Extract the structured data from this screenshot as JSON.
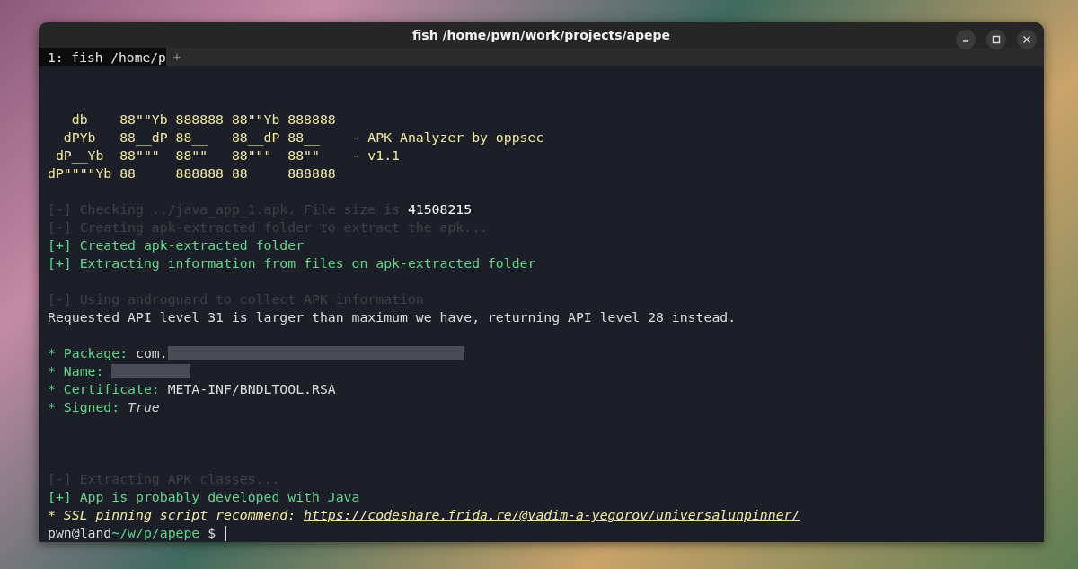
{
  "window": {
    "title": "fish /home/pwn/work/projects/apepe"
  },
  "tabs": [
    {
      "label": "1: fish /home/p",
      "selected": true
    }
  ],
  "new_tab": "+",
  "lines": [
    {
      "kind": "blank"
    },
    {
      "kind": "blank"
    },
    {
      "kind": "text",
      "segments": [
        {
          "kind": "banner",
          "text": "   db    88\"\"Yb 888888 88\"\"Yb 888888"
        }
      ]
    },
    {
      "kind": "text",
      "segments": [
        {
          "kind": "banner",
          "text": "  dPYb   88__dP 88__   88__dP 88__    - APK Analyzer by oppsec"
        }
      ]
    },
    {
      "kind": "text",
      "segments": [
        {
          "kind": "banner",
          "text": " dP__Yb  88\"\"\"  88\"\"   88\"\"\"  88\"\"    - v1.1"
        }
      ]
    },
    {
      "kind": "text",
      "segments": [
        {
          "kind": "banner",
          "text": "dP\"\"\"\"Yb 88     888888 88     888888"
        }
      ]
    },
    {
      "kind": "blank"
    },
    {
      "kind": "text",
      "segments": [
        {
          "kind": "dim",
          "text": "[-] Checking ../java_app_1.apk. File size is "
        },
        {
          "kind": "bright",
          "text": "41508215"
        }
      ]
    },
    {
      "kind": "text",
      "segments": [
        {
          "kind": "dim",
          "text": "[-] Creating apk-extracted folder to extract the apk..."
        }
      ]
    },
    {
      "kind": "text",
      "segments": [
        {
          "kind": "ok",
          "text": "[+] Created apk-extracted folder"
        }
      ]
    },
    {
      "kind": "text",
      "segments": [
        {
          "kind": "ok",
          "text": "[+] Extracting information from files on apk-extracted folder"
        }
      ]
    },
    {
      "kind": "blank"
    },
    {
      "kind": "text",
      "segments": [
        {
          "kind": "dim",
          "text": "[-] Using androguard to collect APK information"
        }
      ]
    },
    {
      "kind": "text",
      "segments": [
        {
          "kind": "plain",
          "text": "Requested API level 31 is larger than maximum we have, returning API level 28 instead."
        }
      ]
    },
    {
      "kind": "blank"
    },
    {
      "kind": "text",
      "segments": [
        {
          "kind": "ok",
          "text": "* Package: "
        },
        {
          "kind": "plain",
          "text": "com."
        },
        {
          "kind": "redacted_long"
        }
      ]
    },
    {
      "kind": "text",
      "segments": [
        {
          "kind": "ok",
          "text": "* Name: "
        },
        {
          "kind": "redacted_short"
        }
      ]
    },
    {
      "kind": "text",
      "segments": [
        {
          "kind": "ok",
          "text": "* Certificate: "
        },
        {
          "kind": "plain",
          "text": "META-INF/BNDLTOOL.RSA"
        }
      ]
    },
    {
      "kind": "text",
      "segments": [
        {
          "kind": "ok",
          "text": "* Signed: "
        },
        {
          "kind": "italic",
          "text": "True"
        }
      ]
    },
    {
      "kind": "blank"
    },
    {
      "kind": "blank"
    },
    {
      "kind": "blank"
    },
    {
      "kind": "text",
      "segments": [
        {
          "kind": "dim",
          "text": "[-] Extracting APK classes..."
        }
      ]
    },
    {
      "kind": "text",
      "segments": [
        {
          "kind": "ok",
          "text": "[+] App is probably developed with Java"
        }
      ]
    },
    {
      "kind": "text",
      "segments": [
        {
          "kind": "note",
          "text": "* SSL pinning script recommend: "
        },
        {
          "kind": "link",
          "text": "https://codeshare.frida.re/@vadim-a-yegorov/universalunpinner/"
        }
      ]
    },
    {
      "kind": "prompt",
      "segments": [
        {
          "kind": "plain",
          "text": "pwn@land"
        },
        {
          "kind": "ok",
          "text": "~/w/p/apepe"
        },
        {
          "kind": "plain",
          "text": " $ "
        }
      ]
    }
  ]
}
